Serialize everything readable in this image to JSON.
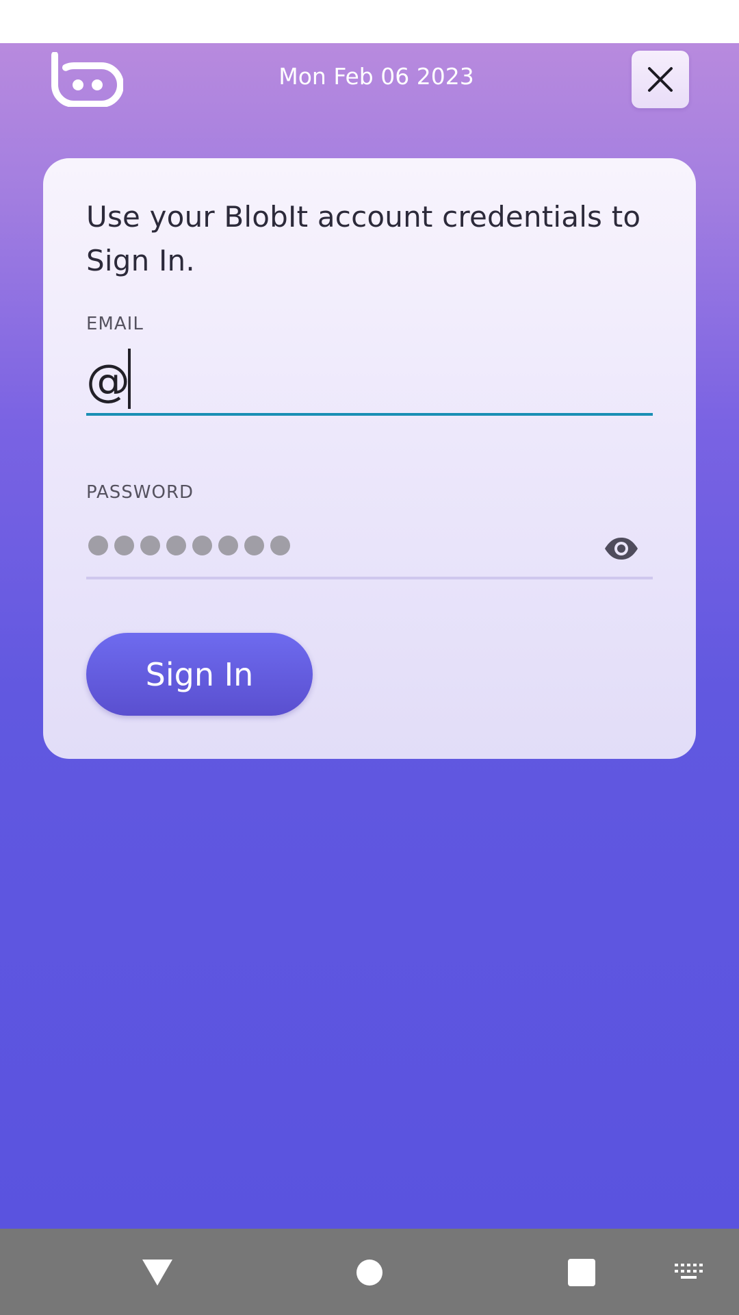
{
  "header": {
    "date": "Mon Feb 06 2023",
    "logo_icon": "blobit-logo-icon",
    "close_icon": "close-icon"
  },
  "form": {
    "intro": "Use your BlobIt account credentials to Sign In.",
    "email": {
      "label": "EMAIL",
      "value": "@"
    },
    "password": {
      "label": "PASSWORD",
      "masked_length": 8,
      "toggle_icon": "eye-icon"
    },
    "submit_label": "Sign In"
  },
  "navigation": {
    "back_icon": "back-triangle-icon",
    "home_icon": "home-circle-icon",
    "recents_icon": "recents-square-icon",
    "keyboard_icon": "keyboard-icon"
  },
  "colors": {
    "accent": "#1a8fb4",
    "button": "#6361e6",
    "background_top": "#b88ade",
    "background_bottom": "#5a53df"
  }
}
